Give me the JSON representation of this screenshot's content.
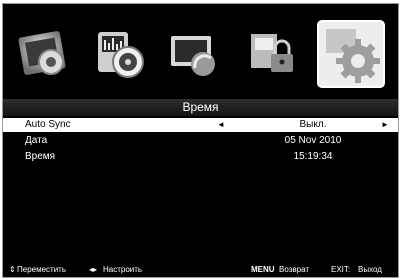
{
  "menu": {
    "title": "Время",
    "icons": [
      {
        "name": "picture-icon"
      },
      {
        "name": "sound-icon"
      },
      {
        "name": "channel-icon"
      },
      {
        "name": "lock-icon"
      },
      {
        "name": "setup-icon",
        "selected": true
      }
    ]
  },
  "items": [
    {
      "label": "Auto Sync",
      "value": "Выкл.",
      "selected": true
    },
    {
      "label": "Дата",
      "value": "05 Nov 2010"
    },
    {
      "label": "Время",
      "value": "15:19:34"
    }
  ],
  "footer": {
    "move_icon": "⇕",
    "move": "Переместить",
    "adjust_icon": "◂▸",
    "adjust": "Настроить",
    "menu_key": "MENU",
    "menu_action": "Возврат",
    "exit_key": "EXIT:",
    "exit_action": "Выход"
  },
  "colors": {
    "highlight": "#ffffff",
    "background": "#000000"
  }
}
